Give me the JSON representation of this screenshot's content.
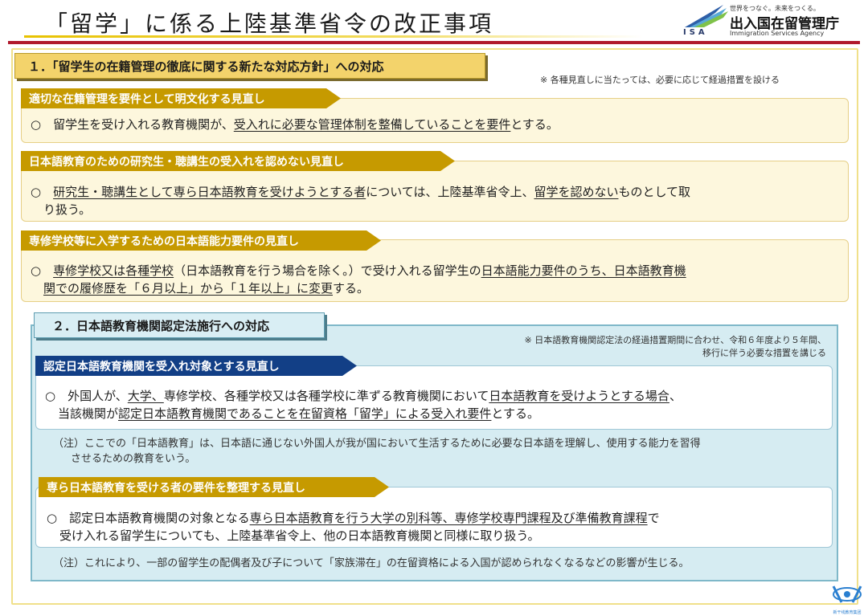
{
  "header": {
    "title": "「留学」に係る上陸基準省令の改正事項",
    "logo": {
      "tagline": "世界をつなぐ。未来をつくる。",
      "acronym": "ISA",
      "name_ja": "出入国在留管理庁",
      "name_en": "Immigration Services Agency"
    }
  },
  "section1": {
    "heading": "１．「留学生の在籍管理の徹底に関する新たな対応方針」への対応",
    "note": "※ 各種見直しに当たっては、必要に応じて経過措置を設ける",
    "items": [
      {
        "tab": "適切な在籍管理を要件として明文化する見直し",
        "text_a": "○　留学生を受け入れる教育機関が、",
        "text_u1": "受入れに必要な管理体制を整備していることを要件",
        "text_b": "とする。"
      },
      {
        "tab": "日本語教育のための研究生・聴講生の受入れを認めない見直し",
        "text_a": "○　",
        "text_u1": "研究生・聴講生として専ら日本語教育を受けようとする者",
        "text_b": "については、上陸基準省令上、",
        "text_u2": "留学を認めない",
        "text_c": "ものとして取",
        "text_d": "り扱う。"
      },
      {
        "tab": "専修学校等に入学するための日本語能力要件の見直し",
        "text_a": "○　",
        "text_u1": "専修学校又は各種学校",
        "text_b": "（日本語教育を行う場合を除く。）で受け入れる留学生の",
        "text_u2": "日本語能力要件のうち、日本語教育機",
        "text_u3": "関での履修歴を「６月以上」から「１年以上」に変更",
        "text_c": "する。"
      }
    ]
  },
  "section2": {
    "heading": "２．日本語教育機関認定法施行への対応",
    "note_line1": "※ 日本語教育機関認定法の経過措置期間に合わせ、令和６年度より５年間、",
    "note_line2": "移行に伴う必要な措置を講じる",
    "items": [
      {
        "tab": "認定日本語教育機関を受入れ対象とする見直し",
        "text_a": "○　外国人が、",
        "text_u1": "大学、",
        "text_b": "専修学校、各種学校又は各種学校に準ずる教育機関において",
        "text_u2": "日本語教育を受けようとする場合",
        "text_c": "、",
        "text_d": "当該機関が",
        "text_u3": "認定日本語教育機関であることを在留資格「留学」による受入れ要件",
        "text_e": "とする。",
        "footnote_line1": "（注）ここでの「日本語教育」は、日本語に通じない外国人が我が国において生活するために必要な日本語を理解し、使用する能力を習得",
        "footnote_line2": "させるための教育をいう。"
      },
      {
        "tab": "専ら日本語教育を受ける者の要件を整理する見直し",
        "text_a": "○　認定日本語教育機関の対象となる",
        "text_u1": "専ら日本語教育を行う大学の別科等、専修学校専門課程及び準備教育課程",
        "text_b": "で",
        "text_c": "受け入れる留学生についても、上陸基準省令上、他の日本語教育機関と同様に取り扱う。",
        "footnote": "（注）これにより、一部の留学生の配偶者及び子について「家族滞在」の在留資格による入国が認められなくなるなどの影響が生じる。"
      }
    ]
  },
  "watermark": {
    "text": "新干线教育集团"
  }
}
